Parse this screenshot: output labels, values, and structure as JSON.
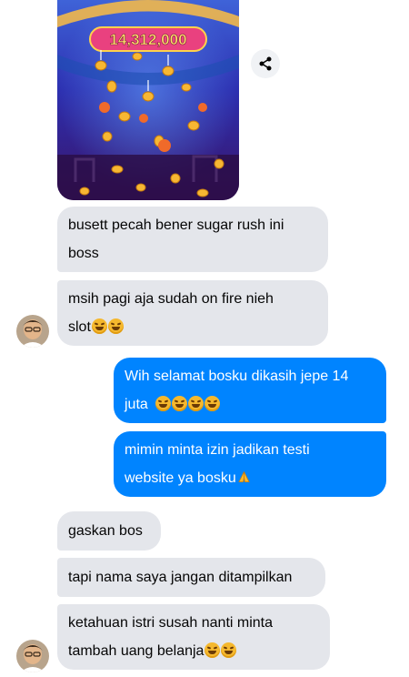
{
  "game": {
    "prize_text": "14,312,000"
  },
  "icons": {
    "share": "share-icon",
    "laugh": "rolling-on-floor-laughing-emoji",
    "blush": "smiling-face-with-hearts-emoji",
    "pray": "folded-hands-emoji"
  },
  "colors": {
    "incoming_bubble": "#e4e6eb",
    "outgoing_bubble": "#0084ff"
  },
  "messages": {
    "m1": {
      "line1": "busett pecah bener sugar rush ini",
      "line2": "boss"
    },
    "m2": {
      "line1": "msih pagi aja sudah on fire nieh",
      "line2": "slot"
    },
    "m3": {
      "line1": "Wih selamat bosku dikasih jepe 14",
      "line2": "juta"
    },
    "m4": {
      "line1": "mimin minta izin jadikan testi",
      "line2": "website ya bosku"
    },
    "m5": {
      "line1": "gaskan bos"
    },
    "m6": {
      "line1": "tapi nama saya jangan ditampilkan"
    },
    "m7": {
      "line1": "ketahuan istri susah nanti minta",
      "line2": "tambah uang belanja"
    }
  }
}
